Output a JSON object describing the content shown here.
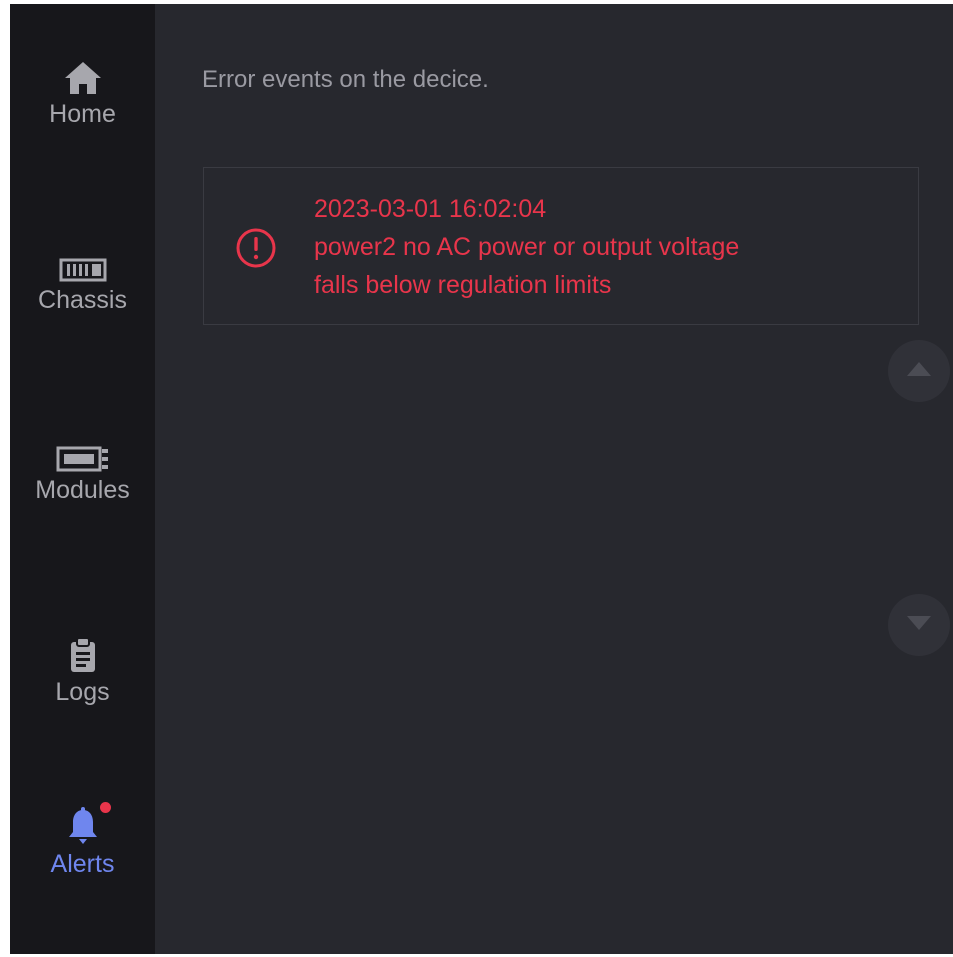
{
  "sidebar": {
    "items": [
      {
        "label": "Home",
        "icon": "home-icon",
        "active": false
      },
      {
        "label": "Chassis",
        "icon": "chassis-icon",
        "active": false
      },
      {
        "label": "Modules",
        "icon": "module-icon",
        "active": false
      },
      {
        "label": "Logs",
        "icon": "clipboard-icon",
        "active": false
      },
      {
        "label": "Alerts",
        "icon": "bell-icon",
        "active": true,
        "has_notification": true
      }
    ]
  },
  "main": {
    "subtitle": "Error events on the decice.",
    "events": [
      {
        "timestamp": "2023-03-01 16:02:04",
        "message_line1": "power2 no AC power or output voltage",
        "message_line2": "falls below regulation limits",
        "icon": "error-circle-icon"
      }
    ],
    "scroll_up_icon": "triangle-up-icon",
    "scroll_down_icon": "triangle-down-icon"
  },
  "colors": {
    "sidebar_bg": "#17171b",
    "main_bg": "#27282e",
    "nav_text": "#a7a7ad",
    "active_accent": "#6f86ee",
    "error": "#e8354b",
    "notification_dot": "#e8354b"
  }
}
